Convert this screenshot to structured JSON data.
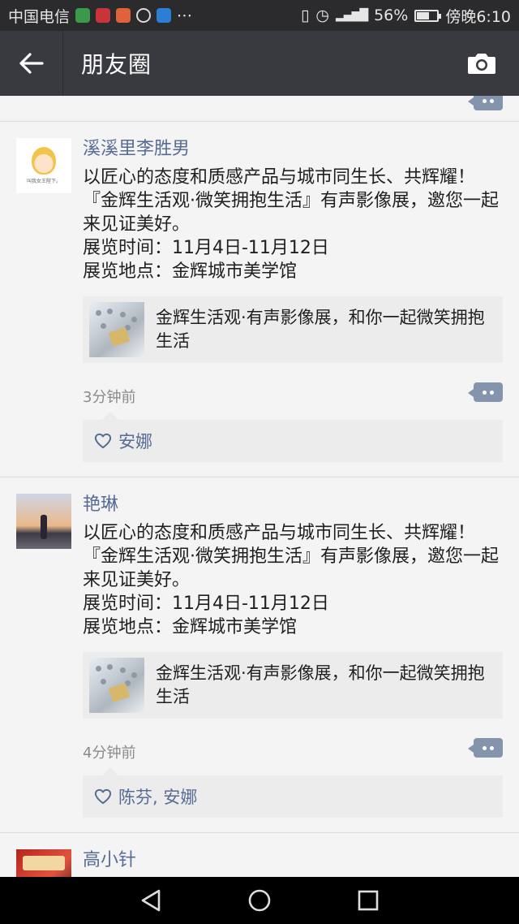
{
  "status_bar": {
    "carrier": "中国电信",
    "battery_text": "56%",
    "battery_level": 0.56,
    "time": "傍晚6:10"
  },
  "header": {
    "title": "朋友圈"
  },
  "icons": {
    "back": "arrow-left-icon",
    "camera": "camera-icon",
    "comment": "comment-dots-icon",
    "like": "heart-outline-icon"
  },
  "colors": {
    "nav_bg": "#393a3f",
    "status_bg": "#2b2b2d",
    "name_link": "#576b95",
    "comment_btn": "#8494ad"
  },
  "posts": [
    {
      "name": "溪溪里李胜男",
      "avatar_caption": "叫我女王陛下。",
      "content": "以匠心的态度和质感产品与城市同生长、共辉耀！『金辉生活观·微笑拥抱生活』有声影像展，邀您一起来见证美好。\n展览时间：11月4日-11月12日\n展览地点：金辉城市美学馆",
      "link_title": "金辉生活观·有声影像展，和你一起微笑拥抱生活",
      "time": "3分钟前",
      "likes": "安娜"
    },
    {
      "name": "艳琳",
      "content": "以匠心的态度和质感产品与城市同生长、共辉耀！『金辉生活观·微笑拥抱生活』有声影像展，邀您一起来见证美好。\n展览时间：11月4日-11月12日\n展览地点：金辉城市美学馆",
      "link_title": "金辉生活观·有声影像展，和你一起微笑拥抱生活",
      "time": "4分钟前",
      "likes": "陈芬, 安娜"
    },
    {
      "name": "高小针"
    }
  ]
}
